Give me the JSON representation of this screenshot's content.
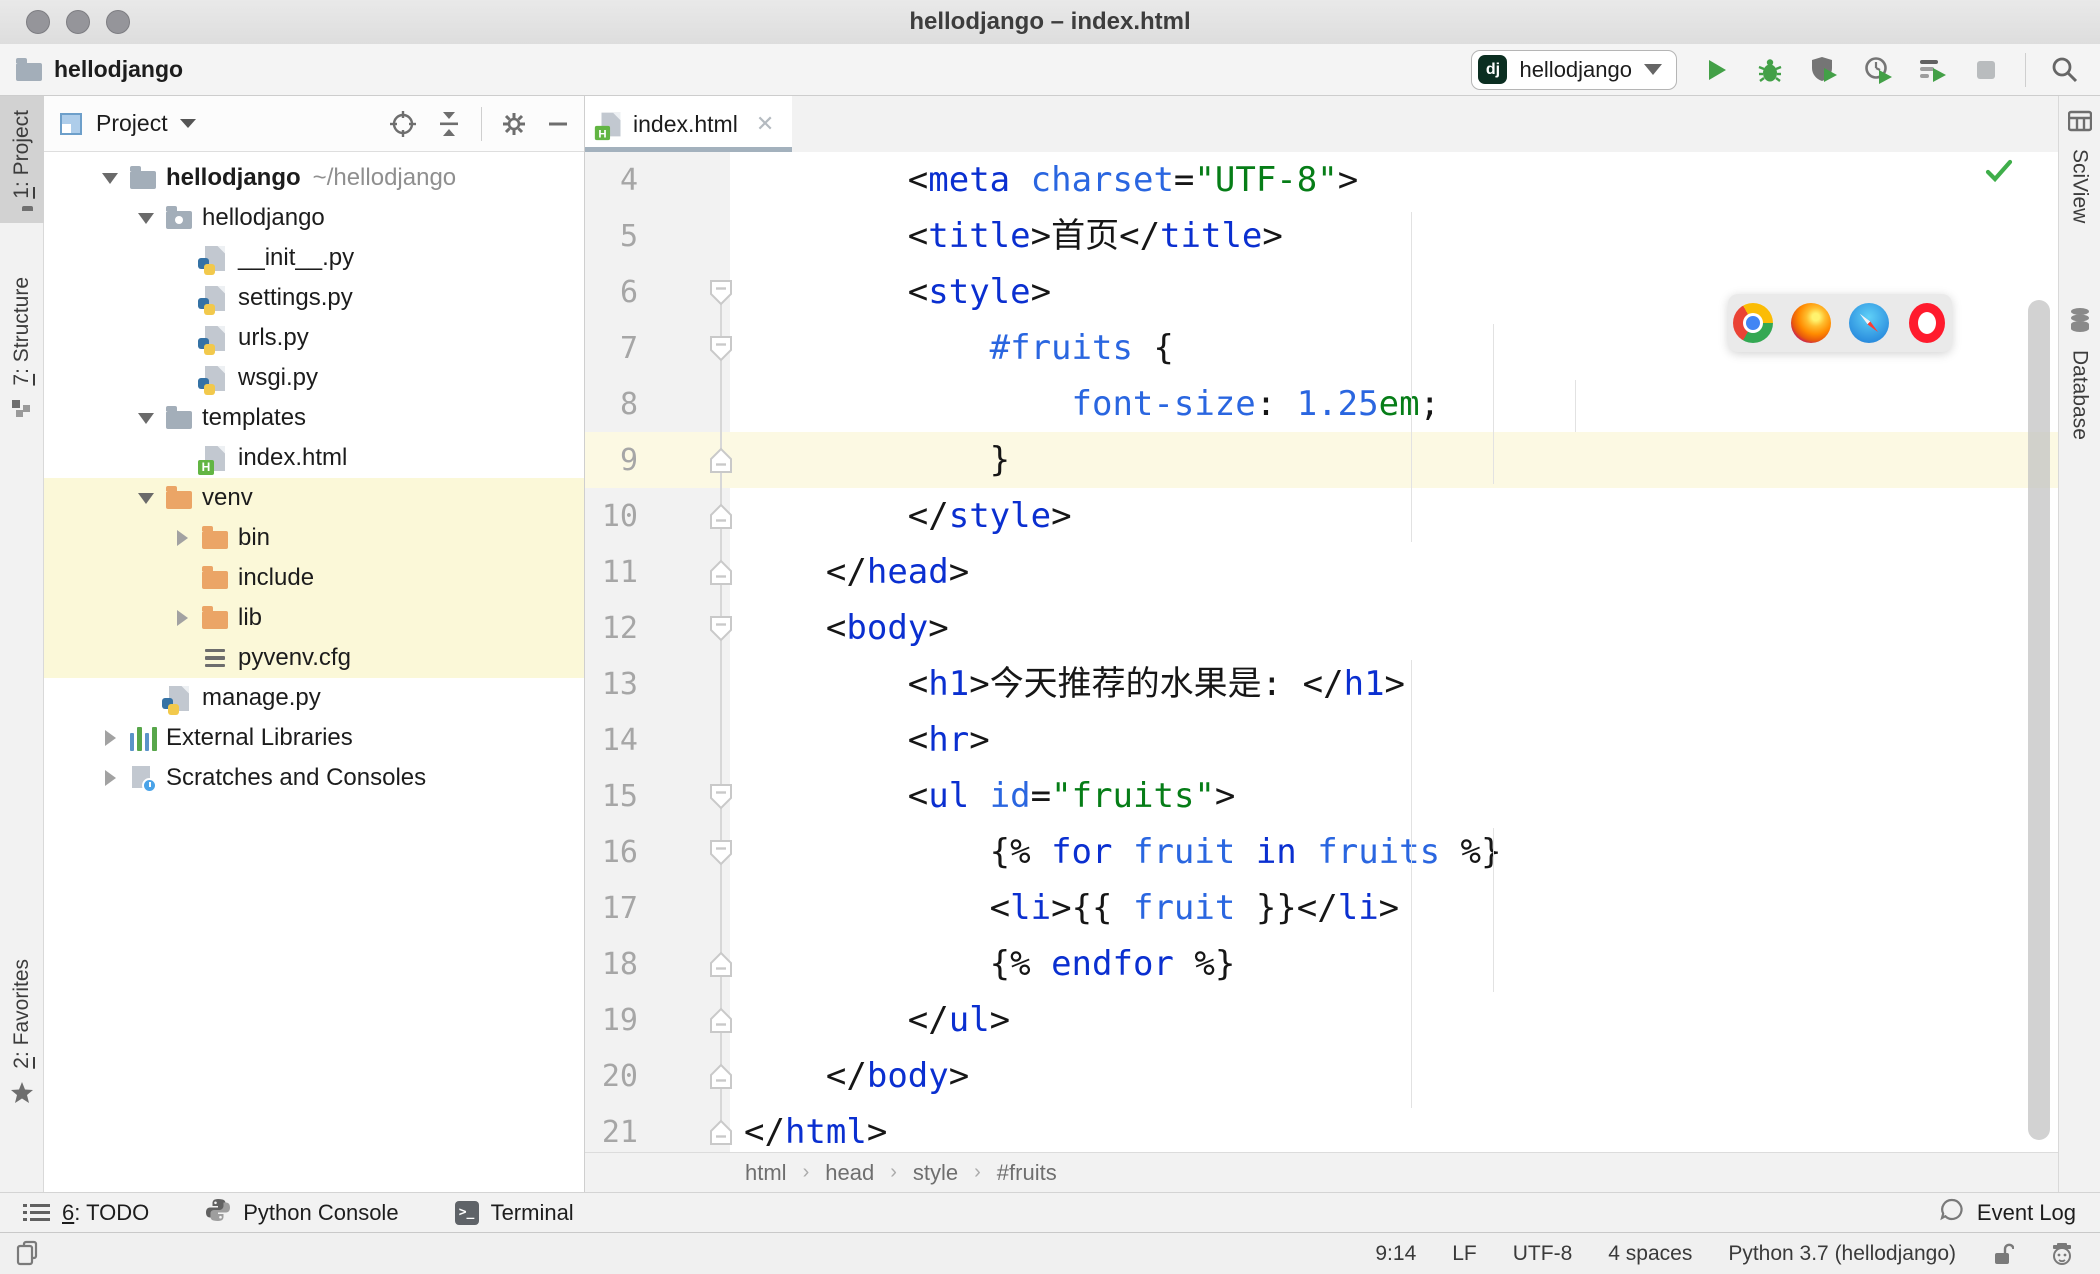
{
  "window": {
    "title": "hellodjango – index.html"
  },
  "toolbar": {
    "project_breadcrumb": "hellodjango",
    "run_config": {
      "badge": "dj",
      "name": "hellodjango"
    },
    "action_icons": [
      "run",
      "debug",
      "run-with-coverage",
      "profile",
      "run-with-settings",
      "stop",
      "search"
    ]
  },
  "left_stripe": [
    {
      "mnemonic": "1",
      "label": ": Project",
      "icon": "project-folder",
      "selected": true
    },
    {
      "mnemonic": "7",
      "label": ": Structure",
      "icon": "structure",
      "selected": false
    },
    {
      "mnemonic": "2",
      "label": ": Favorites",
      "icon": "favorites-star",
      "selected": false
    }
  ],
  "right_stripe": [
    {
      "label": "SciView",
      "icon": "sciview-grid"
    },
    {
      "label": "Database",
      "icon": "database-cylinder"
    }
  ],
  "project_panel": {
    "title": "Project",
    "tree": [
      {
        "label": "hellodjango",
        "suffix": "~/hellodjango",
        "icon": "folder",
        "level": 0,
        "chevron": "down",
        "bold": true,
        "highlight": false
      },
      {
        "label": "hellodjango",
        "suffix": "",
        "icon": "folder-pkg",
        "level": 1,
        "chevron": "down",
        "bold": false,
        "highlight": false
      },
      {
        "label": "__init__.py",
        "suffix": "",
        "icon": "py",
        "level": 2,
        "chevron": null,
        "bold": false,
        "highlight": false
      },
      {
        "label": "settings.py",
        "suffix": "",
        "icon": "py",
        "level": 2,
        "chevron": null,
        "bold": false,
        "highlight": false
      },
      {
        "label": "urls.py",
        "suffix": "",
        "icon": "py",
        "level": 2,
        "chevron": null,
        "bold": false,
        "highlight": false
      },
      {
        "label": "wsgi.py",
        "suffix": "",
        "icon": "py",
        "level": 2,
        "chevron": null,
        "bold": false,
        "highlight": false
      },
      {
        "label": "templates",
        "suffix": "",
        "icon": "folder",
        "level": 1,
        "chevron": "down",
        "bold": false,
        "highlight": false
      },
      {
        "label": "index.html",
        "suffix": "",
        "icon": "html",
        "level": 2,
        "chevron": null,
        "bold": false,
        "highlight": false
      },
      {
        "label": "venv",
        "suffix": "",
        "icon": "folder-orange",
        "level": 1,
        "chevron": "down",
        "bold": false,
        "highlight": true
      },
      {
        "label": "bin",
        "suffix": "",
        "icon": "folder-orange",
        "level": 2,
        "chevron": "right",
        "bold": false,
        "highlight": true
      },
      {
        "label": "include",
        "suffix": "",
        "icon": "folder-orange",
        "level": 2,
        "chevron": null,
        "bold": false,
        "highlight": true
      },
      {
        "label": "lib",
        "suffix": "",
        "icon": "folder-orange",
        "level": 2,
        "chevron": "right",
        "bold": false,
        "highlight": true
      },
      {
        "label": "pyvenv.cfg",
        "suffix": "",
        "icon": "cfg",
        "level": 2,
        "chevron": null,
        "bold": false,
        "highlight": true
      },
      {
        "label": "manage.py",
        "suffix": "",
        "icon": "py",
        "level": 1,
        "chevron": null,
        "bold": false,
        "highlight": false
      },
      {
        "label": "External Libraries",
        "suffix": "",
        "icon": "ext-lib",
        "level": 0,
        "chevron": "right",
        "bold": false,
        "highlight": false
      },
      {
        "label": "Scratches and Consoles",
        "suffix": "",
        "icon": "scratches",
        "level": 0,
        "chevron": "right",
        "bold": false,
        "highlight": false
      }
    ]
  },
  "editor": {
    "tab": {
      "name": "index.html"
    },
    "caret_line": 9,
    "lines": [
      {
        "n": 4,
        "fold": null,
        "seg": [
          [
            "ink",
            "        "
          ],
          [
            "ink",
            "<"
          ],
          [
            "b1",
            "meta"
          ],
          [
            "ink",
            " "
          ],
          [
            "b2",
            "charset"
          ],
          [
            "ink",
            "="
          ],
          [
            "gr",
            "\"UTF-8\""
          ],
          [
            "ink",
            ">"
          ]
        ]
      },
      {
        "n": 5,
        "fold": null,
        "seg": [
          [
            "ink",
            "        "
          ],
          [
            "ink",
            "<"
          ],
          [
            "b1",
            "title"
          ],
          [
            "ink",
            ">"
          ],
          [
            "ink",
            "首页"
          ],
          [
            "ink",
            "</"
          ],
          [
            "b1",
            "title"
          ],
          [
            "ink",
            ">"
          ]
        ]
      },
      {
        "n": 6,
        "fold": "start",
        "seg": [
          [
            "ink",
            "        "
          ],
          [
            "ink",
            "<"
          ],
          [
            "b1",
            "style"
          ],
          [
            "ink",
            ">"
          ]
        ]
      },
      {
        "n": 7,
        "fold": "start",
        "seg": [
          [
            "ink",
            "            "
          ],
          [
            "b2",
            "#fruits"
          ],
          [
            "ink",
            " {"
          ]
        ]
      },
      {
        "n": 8,
        "fold": null,
        "seg": [
          [
            "ink",
            "                "
          ],
          [
            "b2",
            "font-size"
          ],
          [
            "ink",
            ": "
          ],
          [
            "b2",
            "1.25"
          ],
          [
            "gr",
            "em"
          ],
          [
            "ink",
            ";"
          ]
        ]
      },
      {
        "n": 9,
        "fold": "end",
        "seg": [
          [
            "ink",
            "            }"
          ]
        ]
      },
      {
        "n": 10,
        "fold": "end",
        "seg": [
          [
            "ink",
            "        "
          ],
          [
            "ink",
            "</"
          ],
          [
            "b1",
            "style"
          ],
          [
            "ink",
            ">"
          ]
        ]
      },
      {
        "n": 11,
        "fold": "end",
        "seg": [
          [
            "ink",
            "    "
          ],
          [
            "ink",
            "</"
          ],
          [
            "b1",
            "head"
          ],
          [
            "ink",
            ">"
          ]
        ]
      },
      {
        "n": 12,
        "fold": "start",
        "seg": [
          [
            "ink",
            "    "
          ],
          [
            "ink",
            "<"
          ],
          [
            "b1",
            "body"
          ],
          [
            "ink",
            ">"
          ]
        ]
      },
      {
        "n": 13,
        "fold": null,
        "seg": [
          [
            "ink",
            "        "
          ],
          [
            "ink",
            "<"
          ],
          [
            "b1",
            "h1"
          ],
          [
            "ink",
            ">"
          ],
          [
            "ink",
            "今天推荐的水果是: "
          ],
          [
            "ink",
            "</"
          ],
          [
            "b1",
            "h1"
          ],
          [
            "ink",
            ">"
          ]
        ]
      },
      {
        "n": 14,
        "fold": null,
        "seg": [
          [
            "ink",
            "        "
          ],
          [
            "ink",
            "<"
          ],
          [
            "b1",
            "hr"
          ],
          [
            "ink",
            ">"
          ]
        ]
      },
      {
        "n": 15,
        "fold": "start",
        "seg": [
          [
            "ink",
            "        "
          ],
          [
            "ink",
            "<"
          ],
          [
            "b1",
            "ul"
          ],
          [
            "ink",
            " "
          ],
          [
            "b2",
            "id"
          ],
          [
            "ink",
            "="
          ],
          [
            "gr",
            "\"fruits\""
          ],
          [
            "ink",
            ">"
          ]
        ]
      },
      {
        "n": 16,
        "fold": "start",
        "seg": [
          [
            "ink",
            "            "
          ],
          [
            "ink",
            "{% "
          ],
          [
            "b1",
            "for"
          ],
          [
            "ink",
            " "
          ],
          [
            "b2",
            "fruit"
          ],
          [
            "ink",
            " "
          ],
          [
            "b1",
            "in"
          ],
          [
            "ink",
            " "
          ],
          [
            "b2",
            "fruits"
          ],
          [
            "ink",
            " %}"
          ]
        ]
      },
      {
        "n": 17,
        "fold": null,
        "seg": [
          [
            "ink",
            "            "
          ],
          [
            "ink",
            "<"
          ],
          [
            "b1",
            "li"
          ],
          [
            "ink",
            ">"
          ],
          [
            "ink",
            "{{ "
          ],
          [
            "b2",
            "fruit"
          ],
          [
            "ink",
            " }}"
          ],
          [
            "ink",
            "</"
          ],
          [
            "b1",
            "li"
          ],
          [
            "ink",
            ">"
          ]
        ]
      },
      {
        "n": 18,
        "fold": "end",
        "seg": [
          [
            "ink",
            "            "
          ],
          [
            "ink",
            "{% "
          ],
          [
            "b1",
            "endfor"
          ],
          [
            "ink",
            " %}"
          ]
        ]
      },
      {
        "n": 19,
        "fold": "end",
        "seg": [
          [
            "ink",
            "        "
          ],
          [
            "ink",
            "</"
          ],
          [
            "b1",
            "ul"
          ],
          [
            "ink",
            ">"
          ]
        ]
      },
      {
        "n": 20,
        "fold": "end",
        "seg": [
          [
            "ink",
            "    "
          ],
          [
            "ink",
            "</"
          ],
          [
            "b1",
            "body"
          ],
          [
            "ink",
            ">"
          ]
        ]
      },
      {
        "n": 21,
        "fold": "end",
        "seg": [
          [
            "ink",
            "</"
          ],
          [
            "b1",
            "html"
          ],
          [
            "ink",
            ">"
          ]
        ]
      }
    ],
    "breadcrumbs": [
      "html",
      "head",
      "style",
      "#fruits"
    ]
  },
  "browser_popup": [
    "chrome",
    "firefox",
    "safari",
    "opera"
  ],
  "bottom_bar": {
    "left": [
      {
        "mnemonic": "6",
        "label": ": TODO",
        "icon": "todo-list"
      },
      {
        "mnemonic": "",
        "label": "Python Console",
        "icon": "python-logo"
      },
      {
        "mnemonic": "",
        "label": "Terminal",
        "icon": "terminal"
      }
    ],
    "right": {
      "label": "Event Log",
      "icon": "event-log-balloon"
    }
  },
  "status_bar": {
    "items": [
      "9:14",
      "LF",
      "UTF-8",
      "4 spaces",
      "Python 3.7 (hellodjango)"
    ]
  },
  "colors": {
    "syntax_tag_keyword": "#0a2fd0",
    "syntax_attr_var": "#2a66e0",
    "syntax_string": "#067d17",
    "caret_row": "#fcf9e3",
    "venv_highlight": "#fbf8d8",
    "run_green": "#43a047",
    "django_badge": "#0b2e21"
  }
}
